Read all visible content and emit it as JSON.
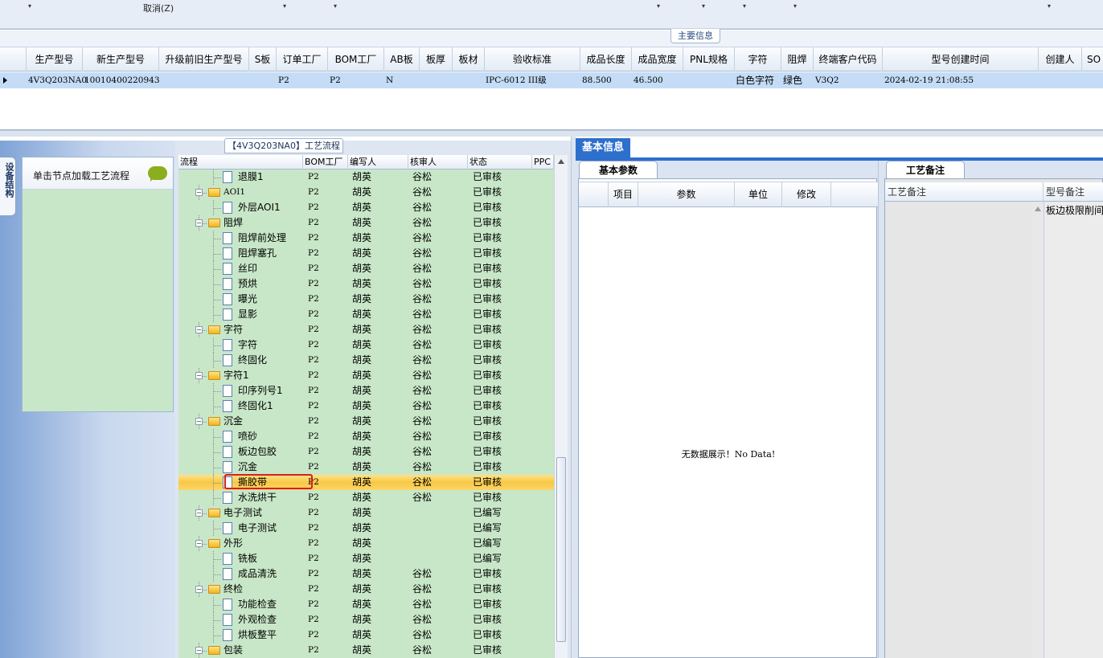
{
  "toolbar": {
    "cancel_label": "取消(Z)",
    "dropdown_arrow": "▾"
  },
  "main_info_label": "主要信息",
  "main_grid": {
    "columns": [
      "生产型号",
      "新生产型号",
      "升级前旧生产型号",
      "S板",
      "订单工厂",
      "BOM工厂",
      "AB板",
      "板厚",
      "板材",
      "验收标准",
      "成品长度",
      "成品宽度",
      "PNL规格",
      "字符",
      "阻焊",
      "终端客户代码",
      "型号创建时间",
      "创建人",
      "SO"
    ],
    "row": {
      "model": "4V3Q203NA0",
      "new_model": "10010400220943",
      "order_factory": "P2",
      "bom_factory": "P2",
      "ab_board": "N",
      "standard": "IPC-6012 III级",
      "length": "88.500",
      "width": "46.500",
      "character": "白色字符",
      "solder_mask": "绿色",
      "customer_code": "V3Q2",
      "created_time": "2024-02-19 21:08:55"
    }
  },
  "left_panel": {
    "vertical_tab": "设备结构",
    "hint": "单击节点加载工艺流程",
    "chat_icon": "speech-bubble"
  },
  "flow_panel": {
    "title": "【4V3Q203NA0】工艺流程",
    "columns": [
      "流程",
      "BOM工厂",
      "编写人",
      "核审人",
      "状态",
      "PPC"
    ],
    "rows": [
      {
        "level": 2,
        "type": "doc",
        "name": "退膜1",
        "bom": "P2",
        "writer": "胡英",
        "reviewer": "谷松",
        "status": "已审核"
      },
      {
        "level": 1,
        "type": "folder",
        "name": "AOI1",
        "bom": "P2",
        "writer": "胡英",
        "reviewer": "谷松",
        "status": "已审核"
      },
      {
        "level": 2,
        "type": "doc",
        "name": "外层AOI1",
        "bom": "P2",
        "writer": "胡英",
        "reviewer": "谷松",
        "status": "已审核"
      },
      {
        "level": 1,
        "type": "folder",
        "name": "阻焊",
        "bom": "P2",
        "writer": "胡英",
        "reviewer": "谷松",
        "status": "已审核"
      },
      {
        "level": 2,
        "type": "doc",
        "name": "阻焊前处理",
        "bom": "P2",
        "writer": "胡英",
        "reviewer": "谷松",
        "status": "已审核"
      },
      {
        "level": 2,
        "type": "doc",
        "name": "阻焊塞孔",
        "bom": "P2",
        "writer": "胡英",
        "reviewer": "谷松",
        "status": "已审核"
      },
      {
        "level": 2,
        "type": "doc",
        "name": "丝印",
        "bom": "P2",
        "writer": "胡英",
        "reviewer": "谷松",
        "status": "已审核"
      },
      {
        "level": 2,
        "type": "doc",
        "name": "预烘",
        "bom": "P2",
        "writer": "胡英",
        "reviewer": "谷松",
        "status": "已审核"
      },
      {
        "level": 2,
        "type": "doc",
        "name": "曝光",
        "bom": "P2",
        "writer": "胡英",
        "reviewer": "谷松",
        "status": "已审核"
      },
      {
        "level": 2,
        "type": "doc",
        "name": "显影",
        "bom": "P2",
        "writer": "胡英",
        "reviewer": "谷松",
        "status": "已审核"
      },
      {
        "level": 1,
        "type": "folder",
        "name": "字符",
        "bom": "P2",
        "writer": "胡英",
        "reviewer": "谷松",
        "status": "已审核"
      },
      {
        "level": 2,
        "type": "doc",
        "name": "字符",
        "bom": "P2",
        "writer": "胡英",
        "reviewer": "谷松",
        "status": "已审核"
      },
      {
        "level": 2,
        "type": "doc",
        "name": "终固化",
        "bom": "P2",
        "writer": "胡英",
        "reviewer": "谷松",
        "status": "已审核"
      },
      {
        "level": 1,
        "type": "folder",
        "name": "字符1",
        "bom": "P2",
        "writer": "胡英",
        "reviewer": "谷松",
        "status": "已审核"
      },
      {
        "level": 2,
        "type": "doc",
        "name": "印序列号1",
        "bom": "P2",
        "writer": "胡英",
        "reviewer": "谷松",
        "status": "已审核"
      },
      {
        "level": 2,
        "type": "doc",
        "name": "终固化1",
        "bom": "P2",
        "writer": "胡英",
        "reviewer": "谷松",
        "status": "已审核"
      },
      {
        "level": 1,
        "type": "folder",
        "name": "沉金",
        "bom": "P2",
        "writer": "胡英",
        "reviewer": "谷松",
        "status": "已审核"
      },
      {
        "level": 2,
        "type": "doc",
        "name": "喷砂",
        "bom": "P2",
        "writer": "胡英",
        "reviewer": "谷松",
        "status": "已审核"
      },
      {
        "level": 2,
        "type": "doc",
        "name": "板边包胶",
        "bom": "P2",
        "writer": "胡英",
        "reviewer": "谷松",
        "status": "已审核"
      },
      {
        "level": 2,
        "type": "doc",
        "name": "沉金",
        "bom": "P2",
        "writer": "胡英",
        "reviewer": "谷松",
        "status": "已审核"
      },
      {
        "level": 2,
        "type": "doc",
        "name": "撕胶带",
        "bom": "P2",
        "writer": "胡英",
        "reviewer": "谷松",
        "status": "已审核",
        "selected": true
      },
      {
        "level": 2,
        "type": "doc",
        "name": "水洗烘干",
        "bom": "P2",
        "writer": "胡英",
        "reviewer": "谷松",
        "status": "已审核"
      },
      {
        "level": 1,
        "type": "folder",
        "name": "电子测试",
        "bom": "P2",
        "writer": "胡英",
        "reviewer": "",
        "status": "已编写"
      },
      {
        "level": 2,
        "type": "doc",
        "name": "电子测试",
        "bom": "P2",
        "writer": "胡英",
        "reviewer": "",
        "status": "已编写"
      },
      {
        "level": 1,
        "type": "folder",
        "name": "外形",
        "bom": "P2",
        "writer": "胡英",
        "reviewer": "",
        "status": "已编写"
      },
      {
        "level": 2,
        "type": "doc",
        "name": "铣板",
        "bom": "P2",
        "writer": "胡英",
        "reviewer": "",
        "status": "已编写"
      },
      {
        "level": 2,
        "type": "doc",
        "name": "成品清洗",
        "bom": "P2",
        "writer": "胡英",
        "reviewer": "谷松",
        "status": "已审核"
      },
      {
        "level": 1,
        "type": "folder",
        "name": "终检",
        "bom": "P2",
        "writer": "胡英",
        "reviewer": "谷松",
        "status": "已审核"
      },
      {
        "level": 2,
        "type": "doc",
        "name": "功能检查",
        "bom": "P2",
        "writer": "胡英",
        "reviewer": "谷松",
        "status": "已审核"
      },
      {
        "level": 2,
        "type": "doc",
        "name": "外观检查",
        "bom": "P2",
        "writer": "胡英",
        "reviewer": "谷松",
        "status": "已审核"
      },
      {
        "level": 2,
        "type": "doc",
        "name": "烘板整平",
        "bom": "P2",
        "writer": "胡英",
        "reviewer": "谷松",
        "status": "已审核"
      },
      {
        "level": 1,
        "type": "folder",
        "name": "包装",
        "bom": "P2",
        "writer": "胡英",
        "reviewer": "谷松",
        "status": "已审核"
      }
    ]
  },
  "basic_info": {
    "tab": "基本信息",
    "params_tab": "基本参数",
    "params_columns": [
      "项目",
      "参数",
      "单位",
      "修改"
    ],
    "no_data_cn": "无数据展示！",
    "no_data_en": "No Data!",
    "memo_tab": "工艺备注",
    "memo_columns": [
      "工艺备注",
      "型号备注"
    ],
    "memo_value": "板边极限削间"
  }
}
